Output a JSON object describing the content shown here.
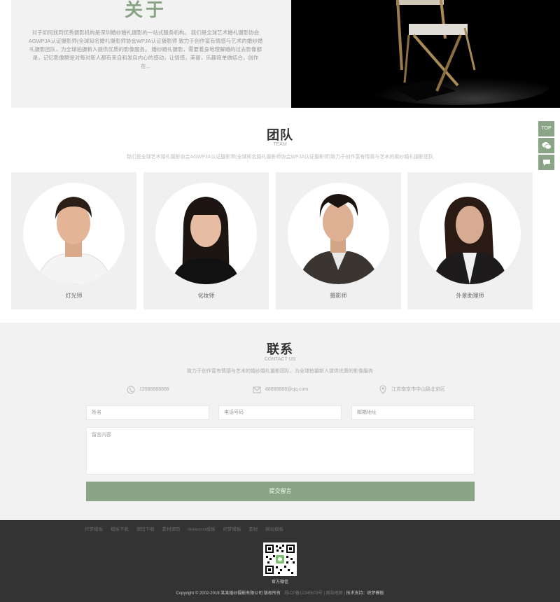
{
  "about": {
    "title": "关于",
    "body": "对于如何找到优秀摄影机构是深圳婚纱婚礼摄影的一站式服务机构。 我们是全球艺术婚礼摄影协会AGWPJA认证摄影师(全球知名婚礼摄影师协会WPJA认证摄影师 致力于创作富有情感与艺术的婚纱婚礼摄影团队，为全球拍摄新人提供优质的影像服务。 婚纱婚礼摄影，需要着身地理解婚的过去影像都是，记忆影像瞬是对每对新人都有来自和发自内心的感动，让情感，美丽，乐趣简单做结合，创作在..."
  },
  "team": {
    "title": "团队",
    "subtitle": "TEAM",
    "description": "我们是全球艺术婚礼摄影协会AGWPJA认证摄影师(全球知名婚礼摄影师协会WPJA认证摄影师)致力于创作富有情感与艺术的婚纱婚礼摄影团队",
    "members": [
      {
        "role": "灯光师"
      },
      {
        "role": "化妆师"
      },
      {
        "role": "摄影师"
      },
      {
        "role": "外景助理师"
      }
    ]
  },
  "contact": {
    "title": "联系",
    "subtitle": "CONTACT US",
    "description": "致力于创作富有情感与艺术的婚纱婚礼摄影团队，为全球拍摄新人提供优质的影像服务",
    "phone": "13588888888",
    "email": "88888888@qq.com",
    "address": "江苏南京市中山路北京区",
    "form": {
      "name_placeholder": "姓名",
      "phone_placeholder": "电话号码",
      "email_placeholder": "邮箱地址",
      "message_placeholder": "留言内容",
      "submit_label": "提交留言"
    }
  },
  "footer": {
    "links": [
      "织梦模板",
      "模板下载",
      "源码下载",
      "素材源码",
      "dedecms模板",
      "织梦模板",
      "素材",
      "网站模板"
    ],
    "qr_label": "官方微信",
    "copyright": "Copyright © 2002-2019 某某婚纱摄影有限公司 版权所有",
    "icp": "苏ICP备12345678号",
    "sitemap": "网站地图",
    "support": "技术支持：织梦模板"
  },
  "side": {
    "top_label": "TOP"
  },
  "colors": {
    "accent": "#8aa585",
    "footer_bg": "#333333",
    "section_bg": "#f2f2f2"
  }
}
